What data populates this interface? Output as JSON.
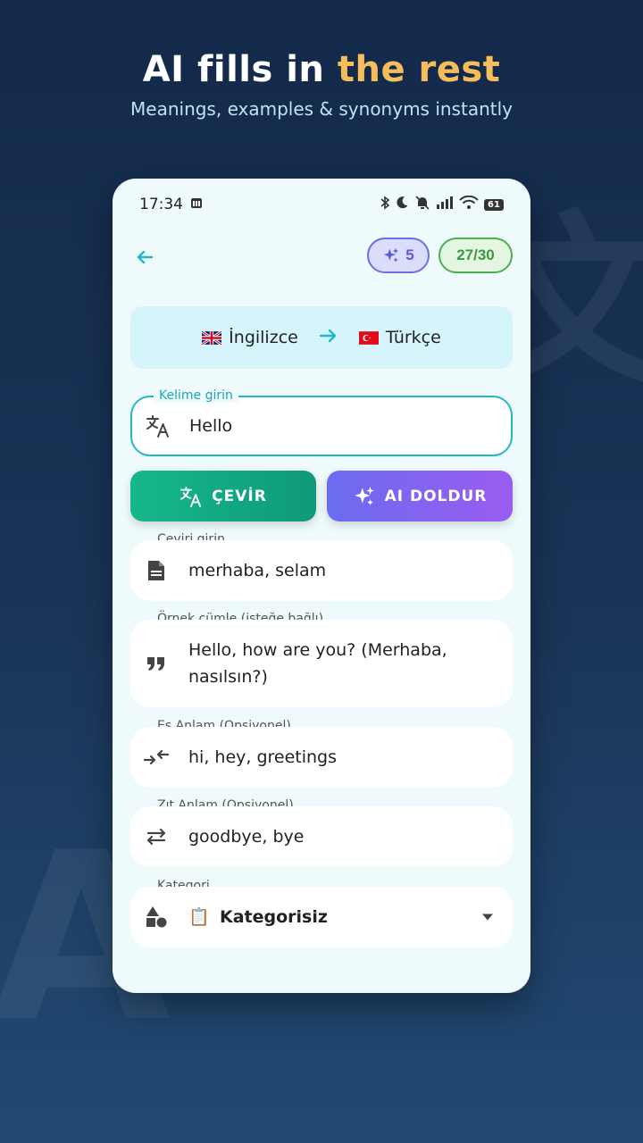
{
  "header": {
    "headline_main": "AI fills in",
    "headline_accent": "the rest",
    "subline": "Meanings, examples & synonyms instantly"
  },
  "status_bar": {
    "time": "17:34",
    "battery": "61"
  },
  "top_bar": {
    "ai_credits": "5",
    "usage_count": "27/30"
  },
  "language_pair": {
    "source": "İngilizce",
    "target": "Türkçe"
  },
  "word_input": {
    "label": "Kelime girin",
    "value": "Hello"
  },
  "buttons": {
    "translate": "ÇEVİR",
    "ai_fill": "AI DOLDUR"
  },
  "fields": {
    "translation": {
      "label": "Çeviri girin",
      "value": "merhaba, selam"
    },
    "example": {
      "label": "Örnek cümle (isteğe bağlı)",
      "line1": "Hello, how are you? (Merhaba,",
      "line2": "nasılsın?)"
    },
    "synonyms": {
      "label": "Eş Anlam (Opsiyonel)",
      "value": "hi, hey, greetings"
    },
    "antonyms": {
      "label": "Zıt Anlam (Opsiyonel)",
      "value": "goodbye, bye"
    },
    "category": {
      "label": "Kategori",
      "emoji": "📋",
      "value": "Kategorisiz"
    }
  },
  "colors": {
    "accent_teal": "#1fb8c8",
    "accent_gold": "#f5be5a",
    "ai_purple": "#6a6cf0",
    "success_green": "#15b88a"
  },
  "icons": {
    "back": "arrow-left-icon",
    "sparkle": "sparkle-icon",
    "translate": "translate-icon",
    "document": "document-icon",
    "quote": "quote-icon",
    "synonym": "arrows-inward-icon",
    "antonym": "swap-horizontal-icon",
    "category": "shapes-icon",
    "dropdown": "caret-down-icon"
  }
}
